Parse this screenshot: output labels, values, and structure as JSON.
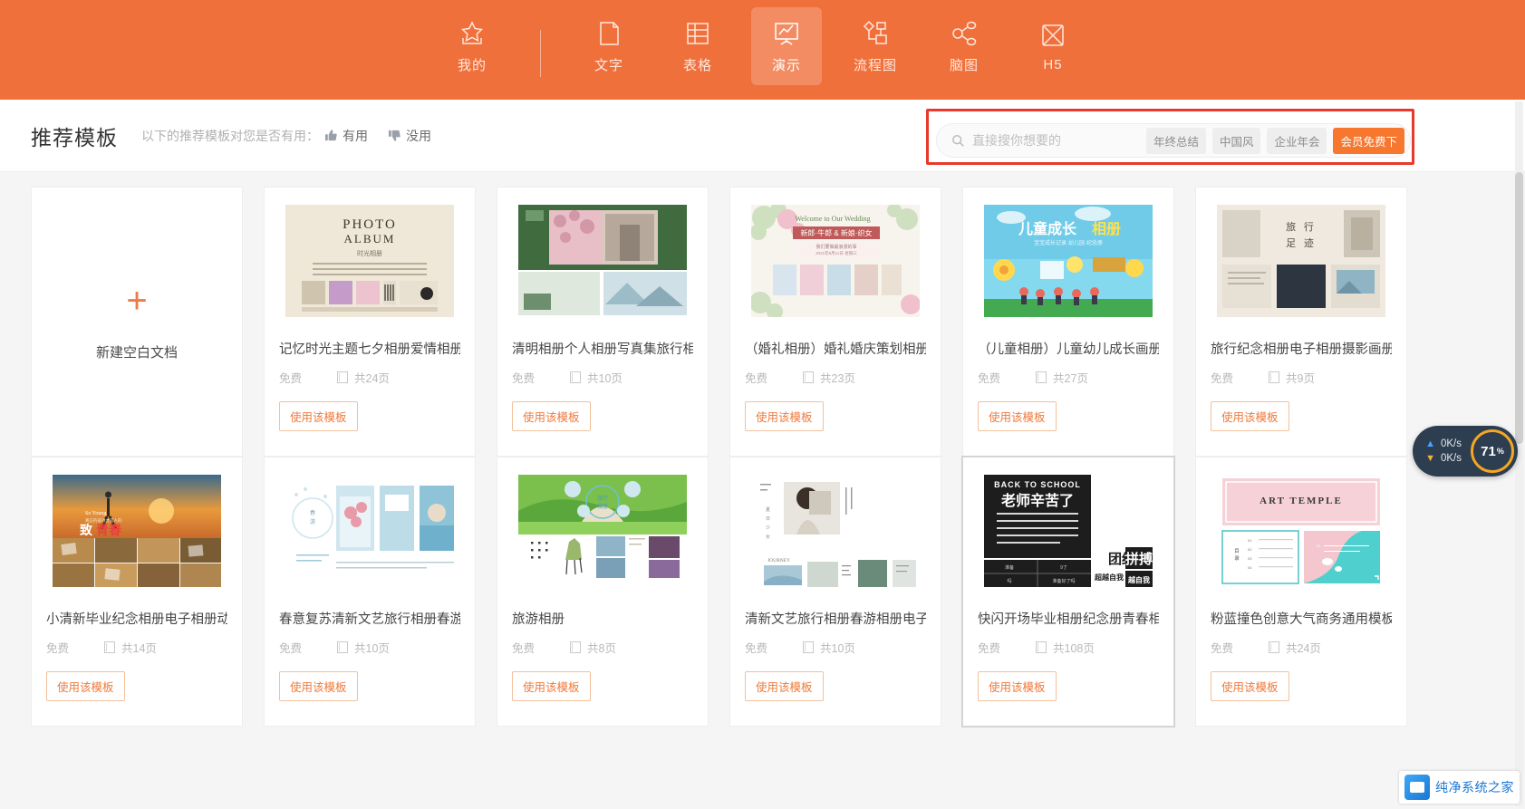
{
  "theme": {
    "brand_orange": "#f0703c",
    "accent_orange": "#ef7a3c",
    "highlight_red": "#e8392c",
    "dial_yellow": "#f5a623"
  },
  "topnav": {
    "items": [
      {
        "label": "我的",
        "icon": "star-bookmark-icon",
        "active": false
      },
      {
        "label": "文字",
        "icon": "document-icon",
        "active": false
      },
      {
        "label": "表格",
        "icon": "table-icon",
        "active": false
      },
      {
        "label": "演示",
        "icon": "presentation-icon",
        "active": true
      },
      {
        "label": "流程图",
        "icon": "flowchart-icon",
        "active": false
      },
      {
        "label": "脑图",
        "icon": "mindmap-icon",
        "active": false
      },
      {
        "label": "H5",
        "icon": "h5-icon",
        "active": false
      }
    ]
  },
  "subheader": {
    "title": "推荐模板",
    "feedback_prompt": "以下的推荐模板对您是否有用：",
    "useful_label": "有用",
    "not_useful_label": "没用"
  },
  "search": {
    "placeholder": "直接搜你想要的",
    "value": "",
    "icon": "search-icon",
    "tags": [
      {
        "label": "年终总结",
        "accent": false
      },
      {
        "label": "中国风",
        "accent": false
      },
      {
        "label": "企业年会",
        "accent": false
      },
      {
        "label": "会员免费下",
        "accent": true
      }
    ]
  },
  "blank_card": {
    "plus": "+",
    "label": "新建空白文档"
  },
  "labels": {
    "price_free": "免费",
    "use_template": "使用该模板",
    "pages_icon": "pages-icon"
  },
  "cards": [
    {
      "title": "记忆时光主题七夕相册爱情相册",
      "price": "免费",
      "pages": "共24页",
      "use_label": "使用该模板",
      "art": "photo-album-vintage",
      "highlighted": false
    },
    {
      "title": "清明相册个人相册写真集旅行相",
      "price": "免费",
      "pages": "共10页",
      "use_label": "使用该模板",
      "art": "qingming-green",
      "highlighted": false
    },
    {
      "title": "（婚礼相册）婚礼婚庆策划相册",
      "price": "免费",
      "pages": "共23页",
      "use_label": "使用该模板",
      "art": "wedding-floral",
      "highlighted": false
    },
    {
      "title": "（儿童相册）儿童幼儿成长画册",
      "price": "免费",
      "pages": "共27页",
      "use_label": "使用该模板",
      "art": "children-growth",
      "highlighted": false
    },
    {
      "title": "旅行纪念相册电子相册摄影画册",
      "price": "免费",
      "pages": "共9页",
      "use_label": "使用该模板",
      "art": "travel-memory",
      "highlighted": false
    },
    {
      "title": "小清新毕业纪念相册电子相册动",
      "price": "免费",
      "pages": "共14页",
      "use_label": "使用该模板",
      "art": "graduation-sunset",
      "highlighted": false
    },
    {
      "title": "春意复苏清新文艺旅行相册春游",
      "price": "免费",
      "pages": "共10页",
      "use_label": "使用该模板",
      "art": "spring-travel",
      "highlighted": false
    },
    {
      "title": "旅游相册",
      "price": "免费",
      "pages": "共8页",
      "use_label": "使用该模板",
      "art": "tour-album-deer",
      "highlighted": false
    },
    {
      "title": "清新文艺旅行相册春游相册电子",
      "price": "免费",
      "pages": "共10页",
      "use_label": "使用该模板",
      "art": "journey-girl",
      "highlighted": false
    },
    {
      "title": "快闪开场毕业相册纪念册青春相",
      "price": "免费",
      "pages": "共108页",
      "use_label": "使用该模板",
      "art": "back-to-school-black",
      "highlighted": true
    },
    {
      "title": "粉蓝撞色创意大气商务通用模板",
      "price": "免费",
      "pages": "共24页",
      "use_label": "使用该模板",
      "art": "art-temple-pink",
      "highlighted": false
    }
  ],
  "speed_widget": {
    "upload": "0K/s",
    "download": "0K/s",
    "percent": "71",
    "percent_unit": "%"
  },
  "watermark": {
    "text": "纯净系统之家",
    "logo": "window-logo-icon"
  }
}
